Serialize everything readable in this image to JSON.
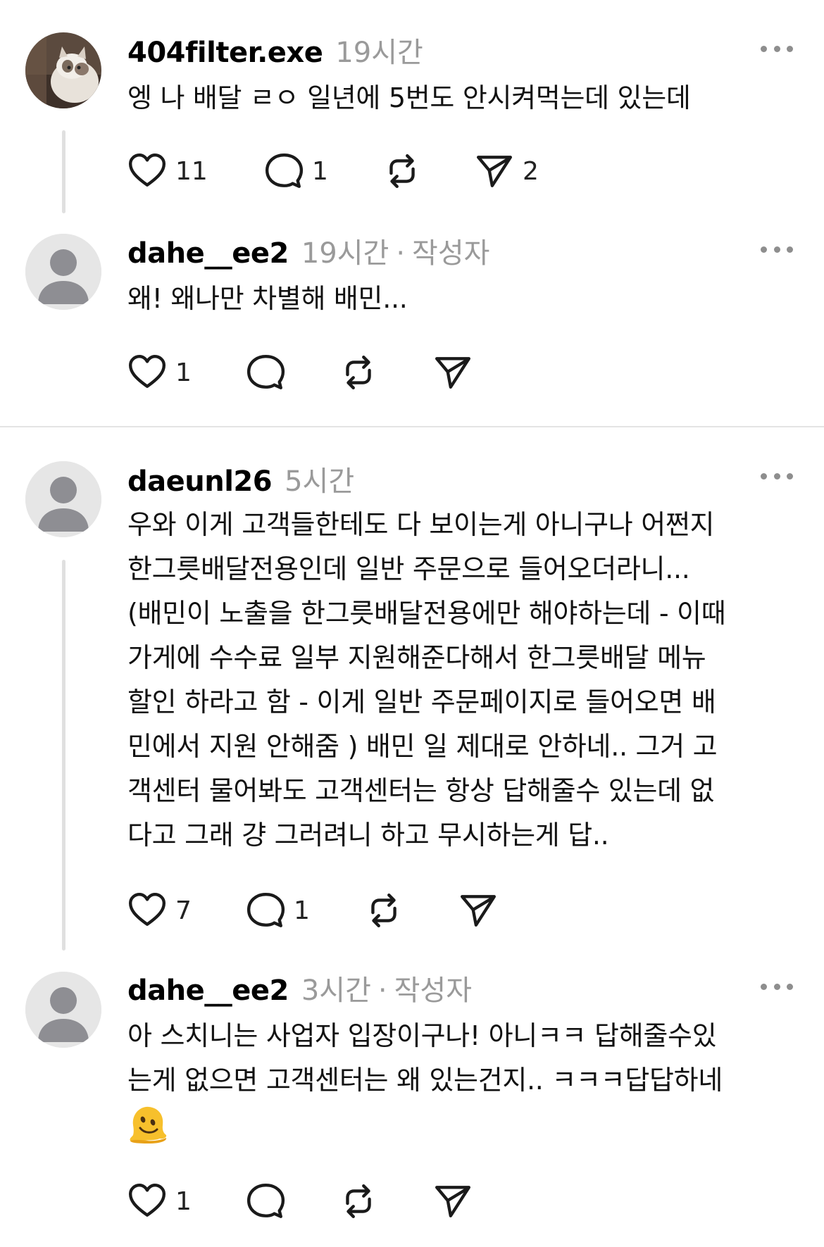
{
  "posts": [
    {
      "username": "404filter.exe",
      "time": "19시간",
      "author_tag": "",
      "text": "엥 나 배달 ㄹㅇ 일년에 5번도 안시켜먹는데 있는데",
      "likes": "11",
      "replies": "1",
      "reposts": "",
      "shares": "2"
    },
    {
      "username": "dahe__ee2",
      "time": "19시간",
      "separator": "·",
      "author_tag": "작성자",
      "text": "왜! 왜나만 차별해 배민...",
      "likes": "1",
      "replies": "",
      "reposts": "",
      "shares": ""
    },
    {
      "username": "daeunl26",
      "time": "5시간",
      "author_tag": "",
      "text": "우와 이게 고객들한테도 다 보이는게 아니구나 어쩐지\n한그릇배달전용인데 일반 주문으로 들어오더라니...\n(배민이 노출을 한그릇배달전용에만 해야하는데 - 이때\n가게에 수수료 일부 지원해준다해서 한그릇배달 메뉴\n할인 하라고 함 - 이게 일반 주문페이지로 들어오면 배\n민에서 지원 안해줌 ) 배민 일 제대로 안하네.. 그거 고\n객센터 물어봐도 고객센터는 항상 답해줄수 있는데 없\n다고 그래 걍 그러려니 하고 무시하는게 답..",
      "likes": "7",
      "replies": "1",
      "reposts": "",
      "shares": ""
    },
    {
      "username": "dahe__ee2",
      "time": "3시간",
      "separator": "·",
      "author_tag": "작성자",
      "text": "아 스치니는 사업자 입장이구나! 아니ㅋㅋ 답해줄수있\n는게 없으면 고객센터는 왜 있는건지.. ㅋㅋㅋ답답하네",
      "emoji": "melting-face-emoji",
      "likes": "1",
      "replies": "",
      "reposts": "",
      "shares": ""
    }
  ],
  "icons": {
    "like": "heart-icon",
    "reply": "comment-icon",
    "repost": "repost-icon",
    "share": "send-icon",
    "more": "more-icon",
    "avatar_default": "default-avatar-icon",
    "avatar_photo": "cat-avatar-photo"
  },
  "colors": {
    "text": "#000000",
    "secondary": "#9a9a9a",
    "divider": "#e4e4e4",
    "avatar_bg": "#e6e6e6",
    "avatar_fg": "#8e8e93"
  }
}
